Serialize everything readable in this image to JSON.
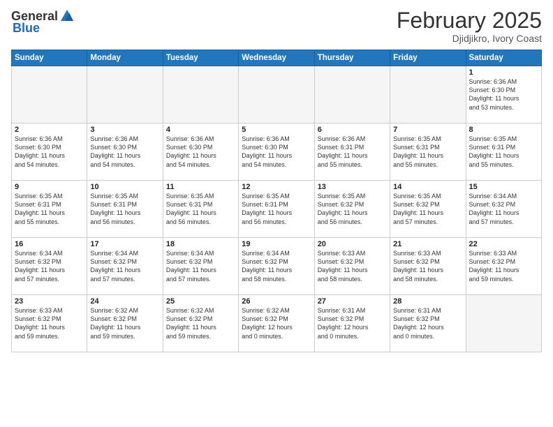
{
  "header": {
    "logo_general": "General",
    "logo_blue": "Blue",
    "month_title": "February 2025",
    "location": "Djidjikro, Ivory Coast"
  },
  "weekdays": [
    "Sunday",
    "Monday",
    "Tuesday",
    "Wednesday",
    "Thursday",
    "Friday",
    "Saturday"
  ],
  "weeks": [
    [
      {
        "day": "",
        "info": ""
      },
      {
        "day": "",
        "info": ""
      },
      {
        "day": "",
        "info": ""
      },
      {
        "day": "",
        "info": ""
      },
      {
        "day": "",
        "info": ""
      },
      {
        "day": "",
        "info": ""
      },
      {
        "day": "1",
        "info": "Sunrise: 6:36 AM\nSunset: 6:30 PM\nDaylight: 11 hours\nand 53 minutes."
      }
    ],
    [
      {
        "day": "2",
        "info": "Sunrise: 6:36 AM\nSunset: 6:30 PM\nDaylight: 11 hours\nand 54 minutes."
      },
      {
        "day": "3",
        "info": "Sunrise: 6:36 AM\nSunset: 6:30 PM\nDaylight: 11 hours\nand 54 minutes."
      },
      {
        "day": "4",
        "info": "Sunrise: 6:36 AM\nSunset: 6:30 PM\nDaylight: 11 hours\nand 54 minutes."
      },
      {
        "day": "5",
        "info": "Sunrise: 6:36 AM\nSunset: 6:30 PM\nDaylight: 11 hours\nand 54 minutes."
      },
      {
        "day": "6",
        "info": "Sunrise: 6:36 AM\nSunset: 6:31 PM\nDaylight: 11 hours\nand 55 minutes."
      },
      {
        "day": "7",
        "info": "Sunrise: 6:35 AM\nSunset: 6:31 PM\nDaylight: 11 hours\nand 55 minutes."
      },
      {
        "day": "8",
        "info": "Sunrise: 6:35 AM\nSunset: 6:31 PM\nDaylight: 11 hours\nand 55 minutes."
      }
    ],
    [
      {
        "day": "9",
        "info": "Sunrise: 6:35 AM\nSunset: 6:31 PM\nDaylight: 11 hours\nand 55 minutes."
      },
      {
        "day": "10",
        "info": "Sunrise: 6:35 AM\nSunset: 6:31 PM\nDaylight: 11 hours\nand 56 minutes."
      },
      {
        "day": "11",
        "info": "Sunrise: 6:35 AM\nSunset: 6:31 PM\nDaylight: 11 hours\nand 56 minutes."
      },
      {
        "day": "12",
        "info": "Sunrise: 6:35 AM\nSunset: 6:31 PM\nDaylight: 11 hours\nand 56 minutes."
      },
      {
        "day": "13",
        "info": "Sunrise: 6:35 AM\nSunset: 6:32 PM\nDaylight: 11 hours\nand 56 minutes."
      },
      {
        "day": "14",
        "info": "Sunrise: 6:35 AM\nSunset: 6:32 PM\nDaylight: 11 hours\nand 57 minutes."
      },
      {
        "day": "15",
        "info": "Sunrise: 6:34 AM\nSunset: 6:32 PM\nDaylight: 11 hours\nand 57 minutes."
      }
    ],
    [
      {
        "day": "16",
        "info": "Sunrise: 6:34 AM\nSunset: 6:32 PM\nDaylight: 11 hours\nand 57 minutes."
      },
      {
        "day": "17",
        "info": "Sunrise: 6:34 AM\nSunset: 6:32 PM\nDaylight: 11 hours\nand 57 minutes."
      },
      {
        "day": "18",
        "info": "Sunrise: 6:34 AM\nSunset: 6:32 PM\nDaylight: 11 hours\nand 57 minutes."
      },
      {
        "day": "19",
        "info": "Sunrise: 6:34 AM\nSunset: 6:32 PM\nDaylight: 11 hours\nand 58 minutes."
      },
      {
        "day": "20",
        "info": "Sunrise: 6:33 AM\nSunset: 6:32 PM\nDaylight: 11 hours\nand 58 minutes."
      },
      {
        "day": "21",
        "info": "Sunrise: 6:33 AM\nSunset: 6:32 PM\nDaylight: 11 hours\nand 58 minutes."
      },
      {
        "day": "22",
        "info": "Sunrise: 6:33 AM\nSunset: 6:32 PM\nDaylight: 11 hours\nand 59 minutes."
      }
    ],
    [
      {
        "day": "23",
        "info": "Sunrise: 6:33 AM\nSunset: 6:32 PM\nDaylight: 11 hours\nand 59 minutes."
      },
      {
        "day": "24",
        "info": "Sunrise: 6:32 AM\nSunset: 6:32 PM\nDaylight: 11 hours\nand 59 minutes."
      },
      {
        "day": "25",
        "info": "Sunrise: 6:32 AM\nSunset: 6:32 PM\nDaylight: 11 hours\nand 59 minutes."
      },
      {
        "day": "26",
        "info": "Sunrise: 6:32 AM\nSunset: 6:32 PM\nDaylight: 12 hours\nand 0 minutes."
      },
      {
        "day": "27",
        "info": "Sunrise: 6:31 AM\nSunset: 6:32 PM\nDaylight: 12 hours\nand 0 minutes."
      },
      {
        "day": "28",
        "info": "Sunrise: 6:31 AM\nSunset: 6:32 PM\nDaylight: 12 hours\nand 0 minutes."
      },
      {
        "day": "",
        "info": ""
      }
    ]
  ]
}
